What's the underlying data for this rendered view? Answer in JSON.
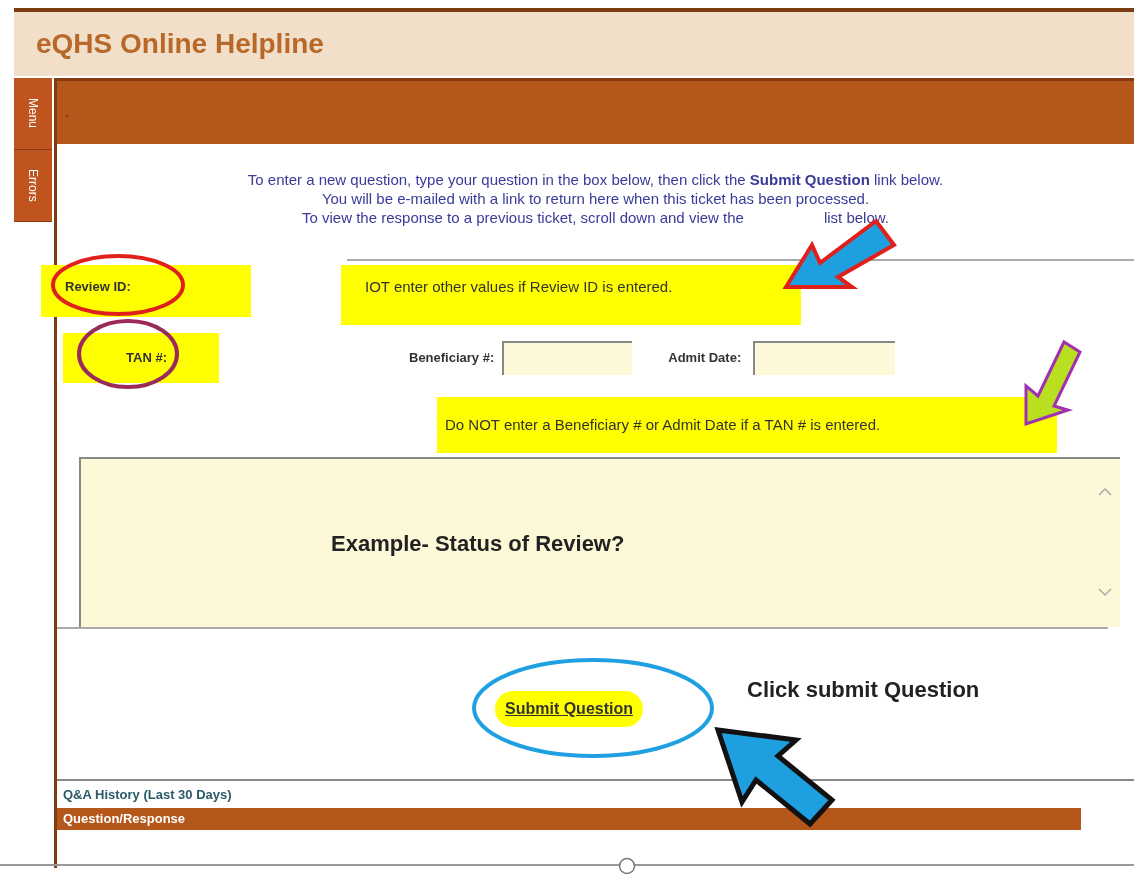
{
  "header": {
    "title": "eQHS Online Helpline"
  },
  "side_tabs": [
    {
      "label": "Menu"
    },
    {
      "label": "Errors"
    }
  ],
  "panel_bar": {
    "text": "."
  },
  "instructions": {
    "line_1": "To enter a new question, type your question in the box below, then click the **Submit Question** link below.",
    "line_2": "You will be e-mailed with a link to return here when this ticket has been processed.",
    "line_3_start": "To view the response to a previous ticket, scroll down and view the",
    "line_3_end": "list below."
  },
  "review_id": {
    "label": "Review ID:",
    "note": "IOT enter other values if Review ID is entered."
  },
  "tan": {
    "label": "TAN #:"
  },
  "beneficiary": {
    "label": "Beneficiary #:"
  },
  "admit_date": {
    "label": "Admit Date:"
  },
  "tan_note": "Do NOT enter a Beneficiary # or Admit Date if a TAN # is entered.",
  "question_box": {
    "value": "Example- Status of Review?"
  },
  "submit": {
    "label": "Submit Question"
  },
  "callout": "Click submit Question",
  "history": {
    "title": "Q&A History (Last 30 Days)",
    "column_header": "Question/Response"
  }
}
